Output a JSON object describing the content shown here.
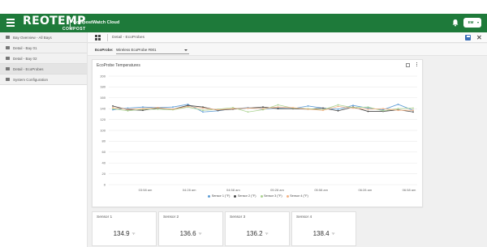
{
  "header": {
    "logo_main": "REOTEMP",
    "logo_sub": "COMPOST",
    "app_name": "CompostWatch Cloud",
    "user_initials": "EM"
  },
  "sidebar": {
    "items": [
      {
        "label": "Bay Overview - All Bays"
      },
      {
        "label": "Detail - Bay 01"
      },
      {
        "label": "Detail - Bay 02"
      },
      {
        "label": "Detail - EcoProbes"
      },
      {
        "label": "System Configuration"
      }
    ]
  },
  "toolbar": {
    "breadcrumb": "Detail - EcoProbes"
  },
  "probe": {
    "label": "EcoProbe:",
    "selected": "Wireless EcoProbe #001"
  },
  "chart": {
    "title": "EcoProbe Temperatures"
  },
  "chart_data": {
    "type": "line",
    "ylim": [
      0,
      200
    ],
    "yticks": [
      "0",
      "20",
      "40",
      "60",
      "80",
      "100",
      "120",
      "140",
      "160",
      "180",
      "200"
    ],
    "x_tick_labels": [
      "03:58 am",
      "04:28 am",
      "04:58 am",
      "05:28 am",
      "05:58 am",
      "06:28 am",
      "06:58 am"
    ],
    "legend_position": "bottom",
    "grid": true,
    "series": [
      {
        "name": "Sensor 1 (°F)",
        "color": "#5b9bd5",
        "values": [
          138,
          141,
          143,
          142,
          143,
          148,
          134,
          136,
          140,
          142,
          139,
          141,
          140,
          145,
          141,
          139,
          146,
          141,
          138,
          148,
          137
        ]
      },
      {
        "name": "Sensor 2 (°F)",
        "color": "#444444",
        "values": [
          145,
          138,
          137,
          141,
          139,
          146,
          143,
          137,
          139,
          141,
          143,
          140,
          140,
          139,
          141,
          136,
          143,
          135,
          135,
          138,
          134
        ]
      },
      {
        "name": "Sensor 3 (°F)",
        "color": "#a9d18e",
        "values": [
          140,
          136,
          139,
          139,
          138,
          143,
          137,
          139,
          142,
          134,
          138,
          147,
          141,
          140,
          138,
          147,
          142,
          143,
          136,
          140,
          141
        ]
      },
      {
        "name": "Sensor 4 (°F)",
        "color": "#f4b183",
        "values": [
          142,
          139,
          140,
          142,
          139,
          144,
          141,
          138,
          140,
          141,
          140,
          143,
          142,
          139,
          137,
          144,
          141,
          139,
          140,
          137,
          137
        ]
      }
    ]
  },
  "sensors": [
    {
      "name": "Sensor 1",
      "value": "134.9",
      "unit": "°F"
    },
    {
      "name": "Sensor 2",
      "value": "136.6",
      "unit": "°F"
    },
    {
      "name": "Sensor 3",
      "value": "136.2",
      "unit": "°F"
    },
    {
      "name": "Sensor 4",
      "value": "138.4",
      "unit": "°F"
    }
  ]
}
